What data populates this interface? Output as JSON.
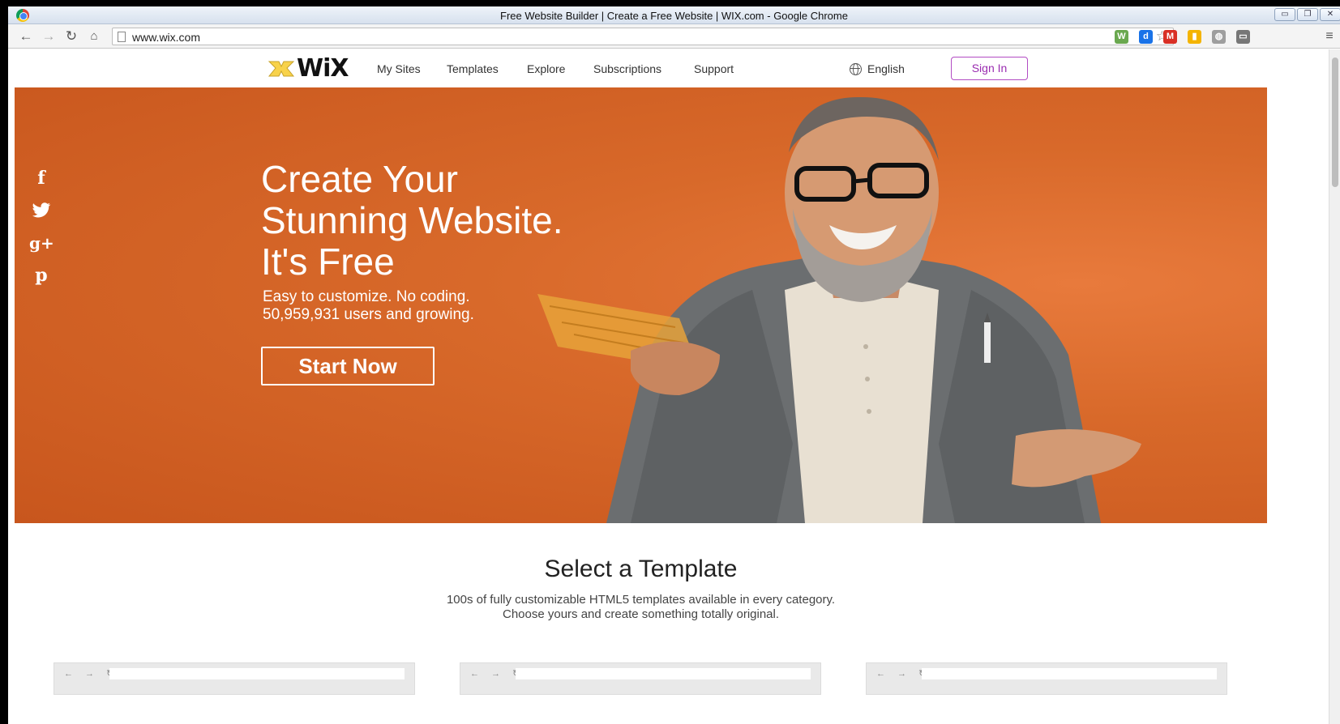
{
  "window": {
    "title": "Free Website Builder | Create a Free Website | WIX.com - Google Chrome",
    "controls": [
      "minimize",
      "restore",
      "close"
    ]
  },
  "toolbar": {
    "url": "www.wix.com",
    "extensions": [
      {
        "name": "w-extension-icon",
        "label": "W",
        "color": "#6aa84f"
      },
      {
        "name": "d-extension-icon",
        "label": "d",
        "color": "#1a73e8"
      },
      {
        "name": "gmail-icon",
        "label": "M",
        "color": "#d93025"
      },
      {
        "name": "clip-extension-icon",
        "label": "▮",
        "color": "#f4b400"
      },
      {
        "name": "chat-extension-icon",
        "label": "◍",
        "color": "#9e9e9e"
      },
      {
        "name": "cast-icon",
        "label": "▭",
        "color": "#777777"
      }
    ]
  },
  "header": {
    "logo": "WiX",
    "nav": [
      "My Sites",
      "Templates",
      "Explore",
      "Subscriptions",
      "Support"
    ],
    "language": "English",
    "sign_in": "Sign In"
  },
  "hero": {
    "title_lines": [
      "Create Your",
      "Stunning Website.",
      "It's Free"
    ],
    "sub_lines": [
      "Easy to customize. No coding.",
      "50,959,931 users and growing."
    ],
    "cta": "Start Now",
    "social": [
      "f",
      "t",
      "g+",
      "p"
    ],
    "background": "#d8692a"
  },
  "templates": {
    "title": "Select a Template",
    "sub_lines": [
      "100s of fully customizable HTML5 templates available in every category.",
      "Choose yours and create something totally original."
    ],
    "card_nav": "← → ↻"
  }
}
